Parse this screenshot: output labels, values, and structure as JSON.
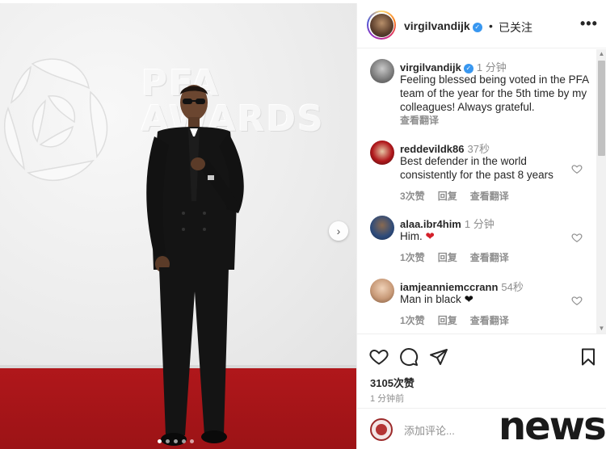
{
  "post": {
    "username": "virgilvandijk",
    "follow_state": "已关注",
    "separator": "•",
    "more": "•••"
  },
  "caption": {
    "username": "virgilvandijk",
    "time": "1 分钟",
    "text": "Feeling blessed being voted in the PFA team of the year for the 5th time by my colleagues! Always grateful.",
    "translate": "查看翻译"
  },
  "comments": [
    {
      "username": "reddevildk86",
      "time": "37秒",
      "text": "Best defender in the world consistently for the past 8 years",
      "likes": "3次赞",
      "reply": "回复",
      "translate": "查看翻译"
    },
    {
      "username": "alaa.ibr4him",
      "time": "1 分钟",
      "text": "Him.",
      "emoji": "❤️",
      "likes": "1次赞",
      "reply": "回复",
      "translate": "查看翻译"
    },
    {
      "username": "iamjeanniemccrann",
      "time": "54秒",
      "text": "Man in black",
      "emoji": "🖤",
      "likes": "1次赞",
      "reply": "回复",
      "translate": "查看翻译"
    }
  ],
  "stats": {
    "likes": "3105次赞",
    "posted": "1 分钟前"
  },
  "composer": {
    "placeholder": "添加评论..."
  },
  "photo": {
    "logo_line1": "PFA",
    "logo_line2": "AWARDS",
    "carousel_total": 5,
    "carousel_active": 1
  },
  "watermark": "news",
  "colors": {
    "accent": "#3897f0",
    "carpet": "#b0171b",
    "muted": "#8e8e8e",
    "heart": "#ed4956"
  }
}
